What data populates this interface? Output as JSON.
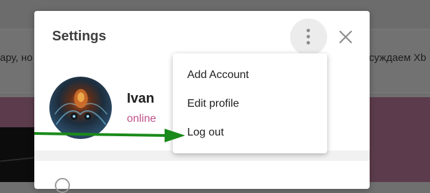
{
  "background": {
    "text_left": "ару, но",
    "text_right": "суждаем Xb"
  },
  "dialog": {
    "title": "Settings",
    "user": {
      "name": "Ivan",
      "status": "online"
    }
  },
  "menu": {
    "items": [
      {
        "label": "Add Account"
      },
      {
        "label": "Edit profile"
      },
      {
        "label": "Log out"
      }
    ]
  },
  "colors": {
    "status": "#c0508a",
    "arrow": "#1a8a1a"
  },
  "icons": {
    "more": "more-vertical-icon",
    "close": "close-icon"
  }
}
